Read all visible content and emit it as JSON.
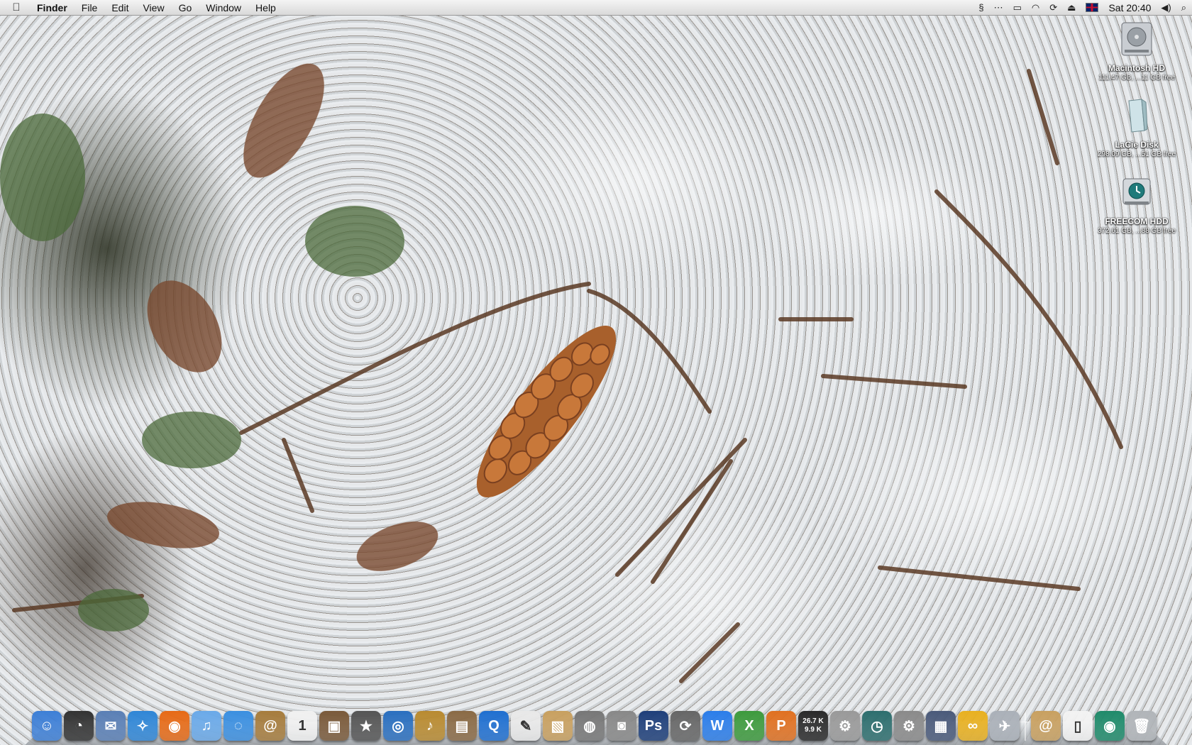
{
  "menubar": {
    "app_name": "Finder",
    "menus": [
      "File",
      "Edit",
      "View",
      "Go",
      "Window",
      "Help"
    ],
    "clock": "Sat 20:40",
    "status_icons": [
      "script-icon",
      "more-icon",
      "display-icon",
      "wifi-icon",
      "sync-icon",
      "eject-icon",
      "uk-flag-icon",
      "volume-icon",
      "spotlight-icon"
    ]
  },
  "desktop": {
    "icons": [
      {
        "name": "Macintosh HD",
        "info": "111.47 GB, ...11 GB free",
        "icon": "hard-drive-icon"
      },
      {
        "name": "LaCie Disk",
        "info": "298.09 GB, ...51 GB free",
        "icon": "external-disk-icon"
      },
      {
        "name": "FREECOM HDD",
        "info": "372.61 GB, ...88 GB free",
        "icon": "time-machine-disk-icon"
      }
    ]
  },
  "dock": {
    "apps": [
      {
        "icon": "finder-icon",
        "color": "#3d7fd6",
        "glyph": "☺"
      },
      {
        "icon": "dashboard-icon",
        "color": "#333333",
        "glyph": "◔"
      },
      {
        "icon": "mail-icon",
        "color": "#5a7fb5",
        "glyph": "✉"
      },
      {
        "icon": "safari-icon",
        "color": "#2f86d6",
        "glyph": "✧"
      },
      {
        "icon": "firefox-icon",
        "color": "#e66a16",
        "glyph": "◉"
      },
      {
        "icon": "itunes-icon",
        "color": "#6aa9e8",
        "glyph": "♫"
      },
      {
        "icon": "ichat-icon",
        "color": "#3b8fe0",
        "glyph": "◌"
      },
      {
        "icon": "address-book-icon",
        "color": "#a67c3d",
        "glyph": "@"
      },
      {
        "icon": "ical-icon",
        "color": "#f0f0f0",
        "glyph": "1"
      },
      {
        "icon": "iphoto-icon",
        "color": "#7a5a3a",
        "glyph": "▣"
      },
      {
        "icon": "imovie-icon",
        "color": "#555555",
        "glyph": "★"
      },
      {
        "icon": "idvd-icon",
        "color": "#2a6fbf",
        "glyph": "◎"
      },
      {
        "icon": "garageband-icon",
        "color": "#b88a30",
        "glyph": "♪"
      },
      {
        "icon": "preview-icon",
        "color": "#8a6a45",
        "glyph": "▤"
      },
      {
        "icon": "quicktime-icon",
        "color": "#1f6fd0",
        "glyph": "Q"
      },
      {
        "icon": "textedit-icon",
        "color": "#e8e8e8",
        "glyph": "✎"
      },
      {
        "icon": "installer-icon",
        "color": "#c8a060",
        "glyph": "▧"
      },
      {
        "icon": "dvd-player-icon",
        "color": "#777777",
        "glyph": "◍"
      },
      {
        "icon": "image-capture-icon",
        "color": "#888888",
        "glyph": "◙"
      },
      {
        "icon": "photoshop-icon",
        "color": "#1e3f7a",
        "glyph": "Ps"
      },
      {
        "icon": "sync-app-icon",
        "color": "#666666",
        "glyph": "⟳"
      },
      {
        "icon": "word-icon",
        "color": "#2b7de9",
        "glyph": "W"
      },
      {
        "icon": "excel-icon",
        "color": "#3d9a3d",
        "glyph": "X"
      },
      {
        "icon": "powerpoint-icon",
        "color": "#e07020",
        "glyph": "P"
      },
      {
        "icon": "network-monitor-icon",
        "color": "#2a2a2a",
        "glyph": "",
        "lines": [
          "26.7 K",
          "9.9 K"
        ]
      },
      {
        "icon": "utility-icon",
        "color": "#999999",
        "glyph": "⚙"
      },
      {
        "icon": "time-machine-icon",
        "color": "#2d6e6e",
        "glyph": "◷"
      },
      {
        "icon": "system-preferences-icon",
        "color": "#8a8a8a",
        "glyph": "⚙"
      },
      {
        "icon": "spaces-icon",
        "color": "#4a5a7a",
        "glyph": "▦"
      },
      {
        "icon": "messenger-icon",
        "color": "#e8b020",
        "glyph": "∞"
      },
      {
        "icon": "automator-icon",
        "color": "#aab0b8",
        "glyph": "✈"
      }
    ],
    "stacks": [
      {
        "icon": "address-stack-icon",
        "color": "#c8a060",
        "glyph": "@"
      },
      {
        "icon": "document-stack-icon",
        "color": "#f2f2f2",
        "glyph": "▯"
      },
      {
        "icon": "downloads-stack-icon",
        "color": "#1f8a6a",
        "glyph": "◉"
      },
      {
        "icon": "trash-icon",
        "color": "#b0b4b8",
        "glyph": "🗑"
      }
    ]
  }
}
